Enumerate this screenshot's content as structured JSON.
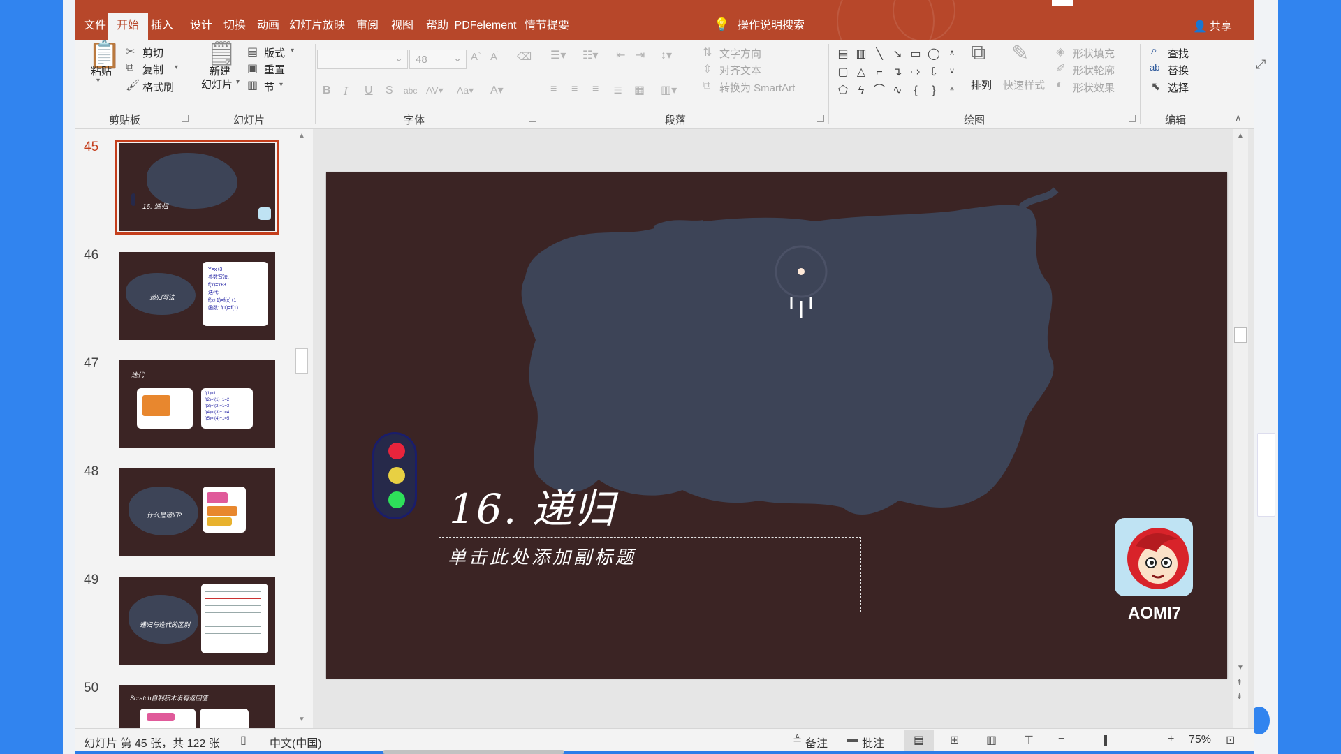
{
  "ribbon_tabs": [
    {
      "label": "文件",
      "active": false
    },
    {
      "label": "开始",
      "active": true
    },
    {
      "label": "插入",
      "active": false
    },
    {
      "label": "设计",
      "active": false
    },
    {
      "label": "切换",
      "active": false
    },
    {
      "label": "动画",
      "active": false
    },
    {
      "label": "幻灯片放映",
      "active": false
    },
    {
      "label": "审阅",
      "active": false
    },
    {
      "label": "视图",
      "active": false
    },
    {
      "label": "帮助",
      "active": false
    },
    {
      "label": "PDFelement",
      "active": false
    },
    {
      "label": "情节提要",
      "active": false
    }
  ],
  "tell_me": "操作说明搜索",
  "share": "共享",
  "clipboard": {
    "paste": "粘贴",
    "cut": "剪切",
    "copy": "复制",
    "format_painter": "格式刷",
    "group": "剪贴板"
  },
  "slides_group": {
    "new_slide_line1": "新建",
    "new_slide_line2": "幻灯片",
    "layout": "版式",
    "reset": "重置",
    "section": "节",
    "group": "幻灯片"
  },
  "font": {
    "font_size": "48",
    "group": "字体",
    "buttons": [
      "B",
      "I",
      "U",
      "S",
      "abc",
      "AV",
      "Aa",
      "A"
    ]
  },
  "paragraph": {
    "text_direction": "文字方向",
    "align_text": "对齐文本",
    "convert_smartart": "转换为 SmartArt",
    "group": "段落"
  },
  "drawing": {
    "arrange": "排列",
    "quick_styles": "快速样式",
    "shape_fill": "形状填充",
    "shape_outline": "形状轮廓",
    "shape_effects": "形状效果",
    "group": "绘图"
  },
  "editing": {
    "find": "查找",
    "replace": "替换",
    "select": "选择",
    "group": "编辑"
  },
  "thumbnails": [
    {
      "num": "45",
      "selected": true,
      "title": "16. 递归"
    },
    {
      "num": "46",
      "selected": false,
      "title": "递归写法",
      "card": [
        "Y=x+3",
        "参数写法:",
        "f(x)=x+3",
        "迭代:",
        "f(x+1)=f(x)+1",
        "函数: f(1)=f(1)"
      ]
    },
    {
      "num": "47",
      "selected": false,
      "title": "迭代",
      "card": [
        "f(1)=1",
        "f(2)=f(1)+1=2",
        "f(3)=f(2)+1=3",
        "f(4)=f(3)+1=4",
        "f(5)=f(4)+1=5"
      ]
    },
    {
      "num": "48",
      "selected": false,
      "title": "什么是递归?"
    },
    {
      "num": "49",
      "selected": false,
      "title": "递归与迭代的区别"
    },
    {
      "num": "50",
      "selected": false,
      "title": "Scratch自制积木没有返回值"
    }
  ],
  "slide": {
    "title": "16. 递归",
    "subtitle_placeholder": "单击此处添加副标题",
    "logo_text": "AOMI7",
    "traffic_colors": {
      "red": "#e8243c",
      "yellow": "#e8d043",
      "green": "#2ee05a"
    }
  },
  "status": {
    "slide_info": "幻灯片 第 45 张，共 122 张",
    "language": "中文(中国)",
    "notes": "备注",
    "comments": "批注",
    "zoom": "75%"
  },
  "colors": {
    "accent": "#b7472a",
    "slide_bg": "#3b2424",
    "blob": "#3d4457"
  }
}
